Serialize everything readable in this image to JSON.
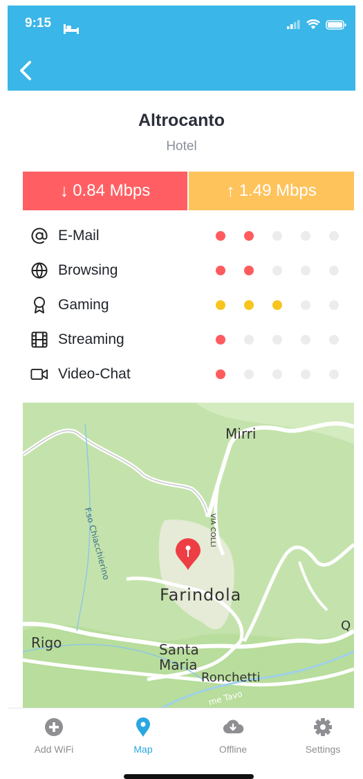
{
  "status": {
    "time": "9:15"
  },
  "place": {
    "name": "Altrocanto",
    "type": "Hotel"
  },
  "speeds": {
    "download": "0.84 Mbps",
    "upload": "1.49 Mbps",
    "download_color": "#ff5f63",
    "upload_color": "#ffc35c"
  },
  "ratings": [
    {
      "label": "E-Mail",
      "icon": "at-icon",
      "score": 2,
      "color": "red"
    },
    {
      "label": "Browsing",
      "icon": "globe-icon",
      "score": 2,
      "color": "red"
    },
    {
      "label": "Gaming",
      "icon": "award-icon",
      "score": 3,
      "color": "yellow"
    },
    {
      "label": "Streaming",
      "icon": "film-icon",
      "score": 1,
      "color": "red"
    },
    {
      "label": "Video-Chat",
      "icon": "video-camera-icon",
      "score": 1,
      "color": "red"
    }
  ],
  "map": {
    "labels": {
      "mirri": "Mirri",
      "via_colli": "VIA COLLI",
      "chiacchierino": "F.so Chiacchierino",
      "farindola": "Farindola",
      "rigo": "Rigo",
      "santa": "Santa",
      "maria": "Maria",
      "ronchetti": "Ronchetti",
      "tavo": "me Tavo",
      "q": "Q"
    }
  },
  "tabs": [
    {
      "label": "Add WiFi",
      "icon": "plus-circle-icon",
      "active": false
    },
    {
      "label": "Map",
      "icon": "map-pin-icon",
      "active": true
    },
    {
      "label": "Offline",
      "icon": "cloud-download-icon",
      "active": false
    },
    {
      "label": "Settings",
      "icon": "gear-icon",
      "active": false
    }
  ]
}
